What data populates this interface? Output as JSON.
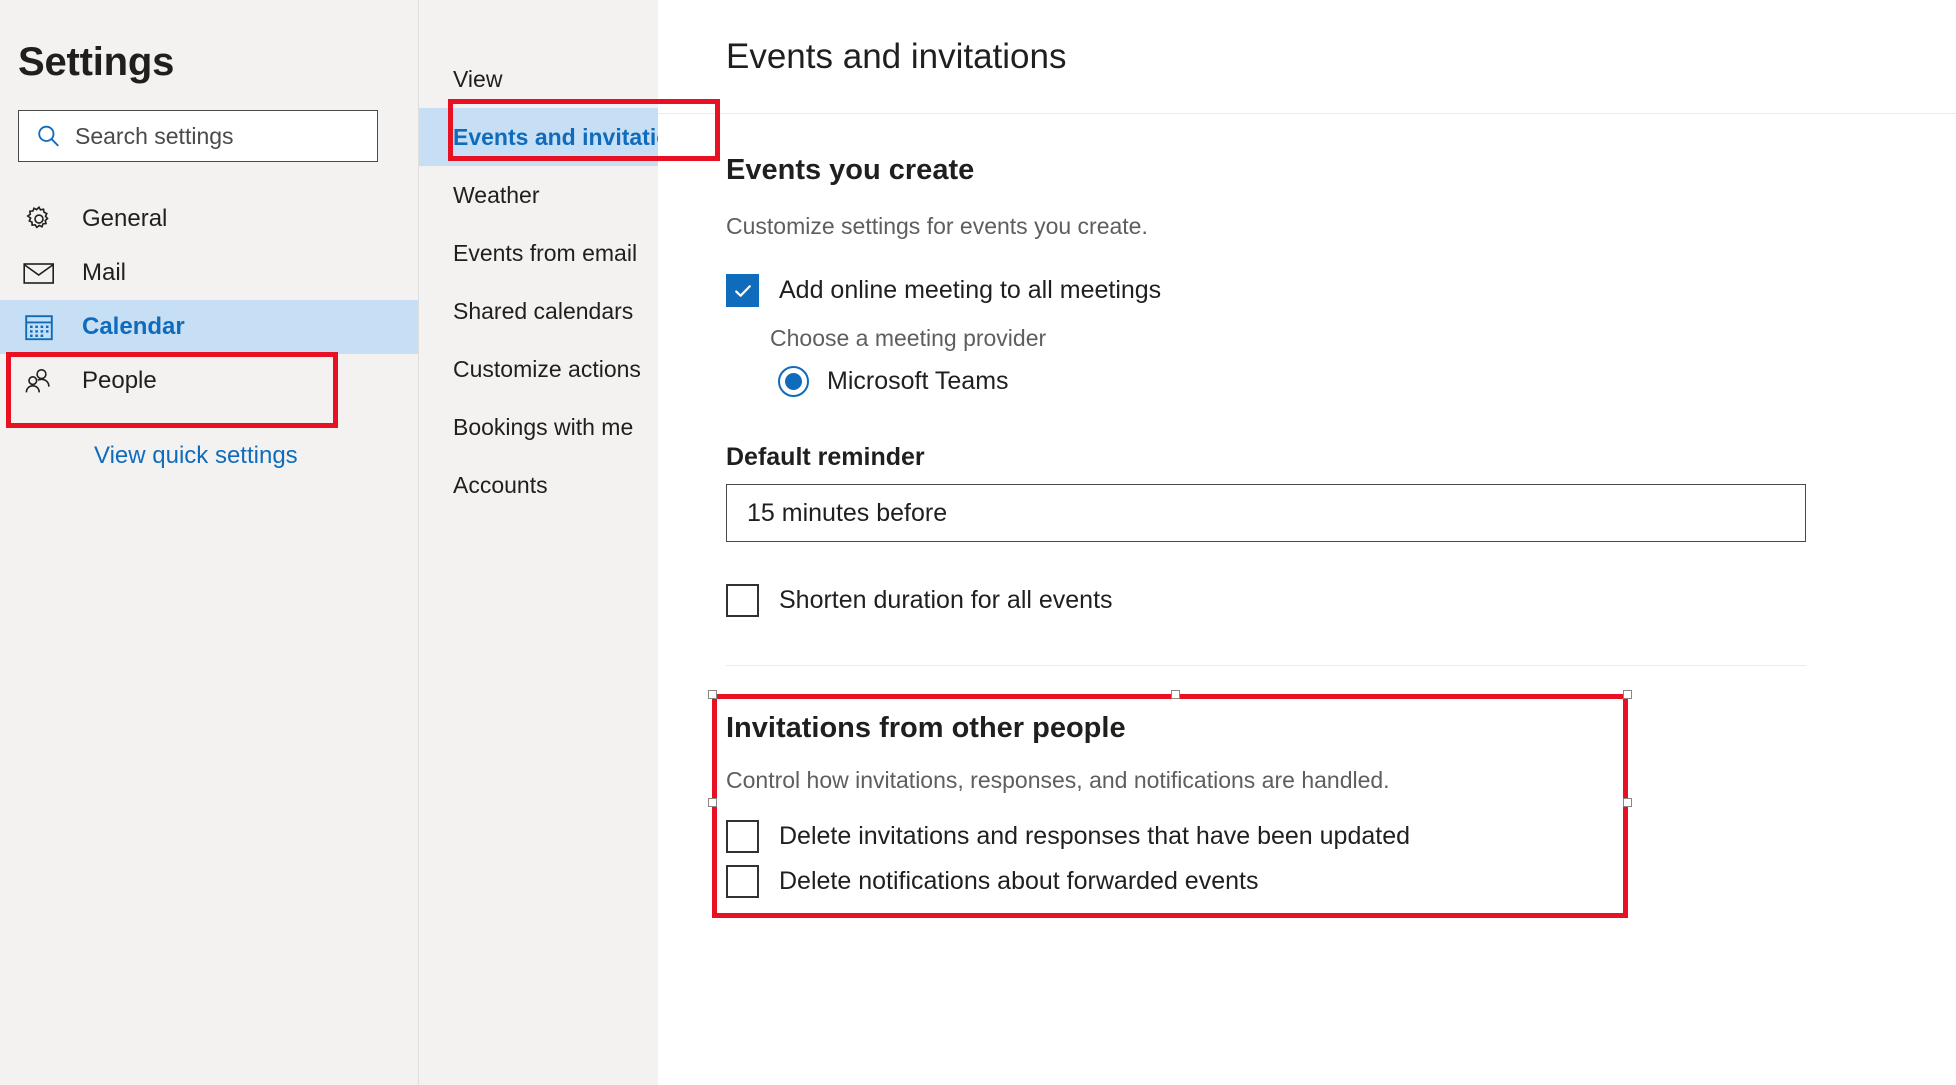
{
  "sidebar": {
    "title": "Settings",
    "search": {
      "placeholder": "Search settings",
      "value": "",
      "icon": "search-icon"
    },
    "items": [
      {
        "label": "General",
        "icon": "gear-icon",
        "selected": false
      },
      {
        "label": "Mail",
        "icon": "envelope-icon",
        "selected": false
      },
      {
        "label": "Calendar",
        "icon": "calendar-icon",
        "selected": true
      },
      {
        "label": "People",
        "icon": "people-icon",
        "selected": false
      }
    ],
    "quick_settings_link": "View quick settings"
  },
  "midcol": {
    "items": [
      {
        "label": "View",
        "selected": false
      },
      {
        "label": "Events and invitations",
        "selected": true
      },
      {
        "label": "Weather",
        "selected": false
      },
      {
        "label": "Events from email",
        "selected": false
      },
      {
        "label": "Shared calendars",
        "selected": false
      },
      {
        "label": "Customize actions",
        "selected": false
      },
      {
        "label": "Bookings with me",
        "selected": false
      },
      {
        "label": "Accounts",
        "selected": false
      }
    ]
  },
  "content": {
    "title": "Events and invitations",
    "events_you_create": {
      "heading": "Events you create",
      "description": "Customize settings for events you create.",
      "add_online_meeting": {
        "label": "Add online meeting to all meetings",
        "checked": true
      },
      "provider_label": "Choose a meeting provider",
      "provider_options": [
        {
          "label": "Microsoft Teams",
          "selected": true
        }
      ],
      "default_reminder": {
        "label": "Default reminder",
        "value": "15 minutes before"
      },
      "shorten_duration": {
        "label": "Shorten duration for all events",
        "checked": false
      }
    },
    "invitations_from_others": {
      "heading": "Invitations from other people",
      "description": "Control how invitations, responses, and notifications are handled.",
      "options": [
        {
          "label": "Delete invitations and responses that have been updated",
          "checked": false
        },
        {
          "label": "Delete notifications about forwarded events",
          "checked": false
        }
      ]
    }
  },
  "colors": {
    "accent": "#0f6cbd",
    "selection_bg": "#c7dff5",
    "annotation_red": "#e81123",
    "panel_bg": "#f3f2f1"
  }
}
